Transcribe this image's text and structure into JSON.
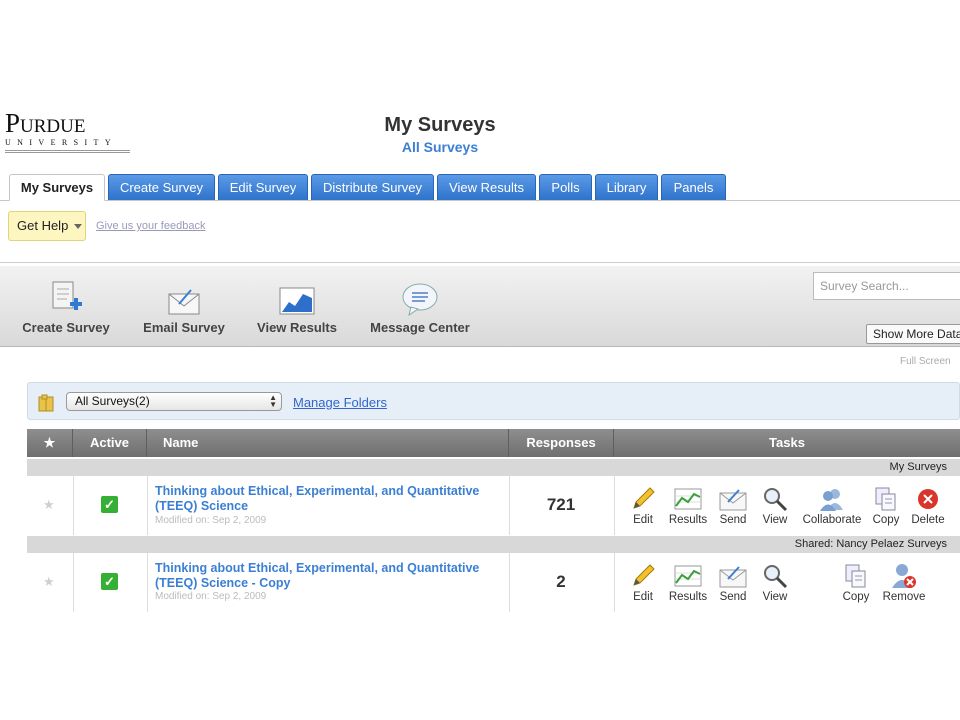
{
  "logo": {
    "main": "Purdue",
    "sub": "UNIVERSITY"
  },
  "header": {
    "title": "My Surveys",
    "subtitle": "All Surveys"
  },
  "tabs": [
    "My Surveys",
    "Create Survey",
    "Edit Survey",
    "Distribute Survey",
    "View Results",
    "Polls",
    "Library",
    "Panels"
  ],
  "help": {
    "label": "Get Help",
    "feedback": "Give us your feedback"
  },
  "toolbar": {
    "items": [
      {
        "label": "Create Survey",
        "icon": "create-survey-icon"
      },
      {
        "label": "Email Survey",
        "icon": "email-icon"
      },
      {
        "label": "View Results",
        "icon": "results-chart-icon"
      },
      {
        "label": "Message Center",
        "icon": "speech-bubble-icon"
      }
    ],
    "search_placeholder": "Survey Search...",
    "show_more": "Show More Data",
    "full_screen": "Full Screen"
  },
  "folders": {
    "selected": "All Surveys(2)",
    "manage": "Manage Folders"
  },
  "table": {
    "headers": {
      "star": "★",
      "active": "Active",
      "name": "Name",
      "responses": "Responses",
      "tasks": "Tasks"
    },
    "groups": [
      {
        "label": "My Surveys",
        "row": {
          "name": "Thinking about Ethical, Experimental, and Quantitative (TEEQ) Science",
          "modified": "Modified on: Sep 2, 2009",
          "responses": "721",
          "tasks": [
            "Edit",
            "Results",
            "Send",
            "View",
            "Collaborate",
            "Copy",
            "Delete"
          ]
        }
      },
      {
        "label": "Shared: Nancy Pelaez Surveys",
        "row": {
          "name": "Thinking about Ethical, Experimental, and Quantitative (TEEQ) Science - Copy",
          "modified": "Modified on: Sep 2, 2009",
          "responses": "2",
          "tasks": [
            "Edit",
            "Results",
            "Send",
            "View",
            "Copy",
            "Remove"
          ]
        }
      }
    ]
  },
  "colors": {
    "tab_blue": "#3b82dc",
    "link_blue": "#3b7fd4",
    "check_green": "#35b035",
    "delete_red": "#d9362b"
  }
}
